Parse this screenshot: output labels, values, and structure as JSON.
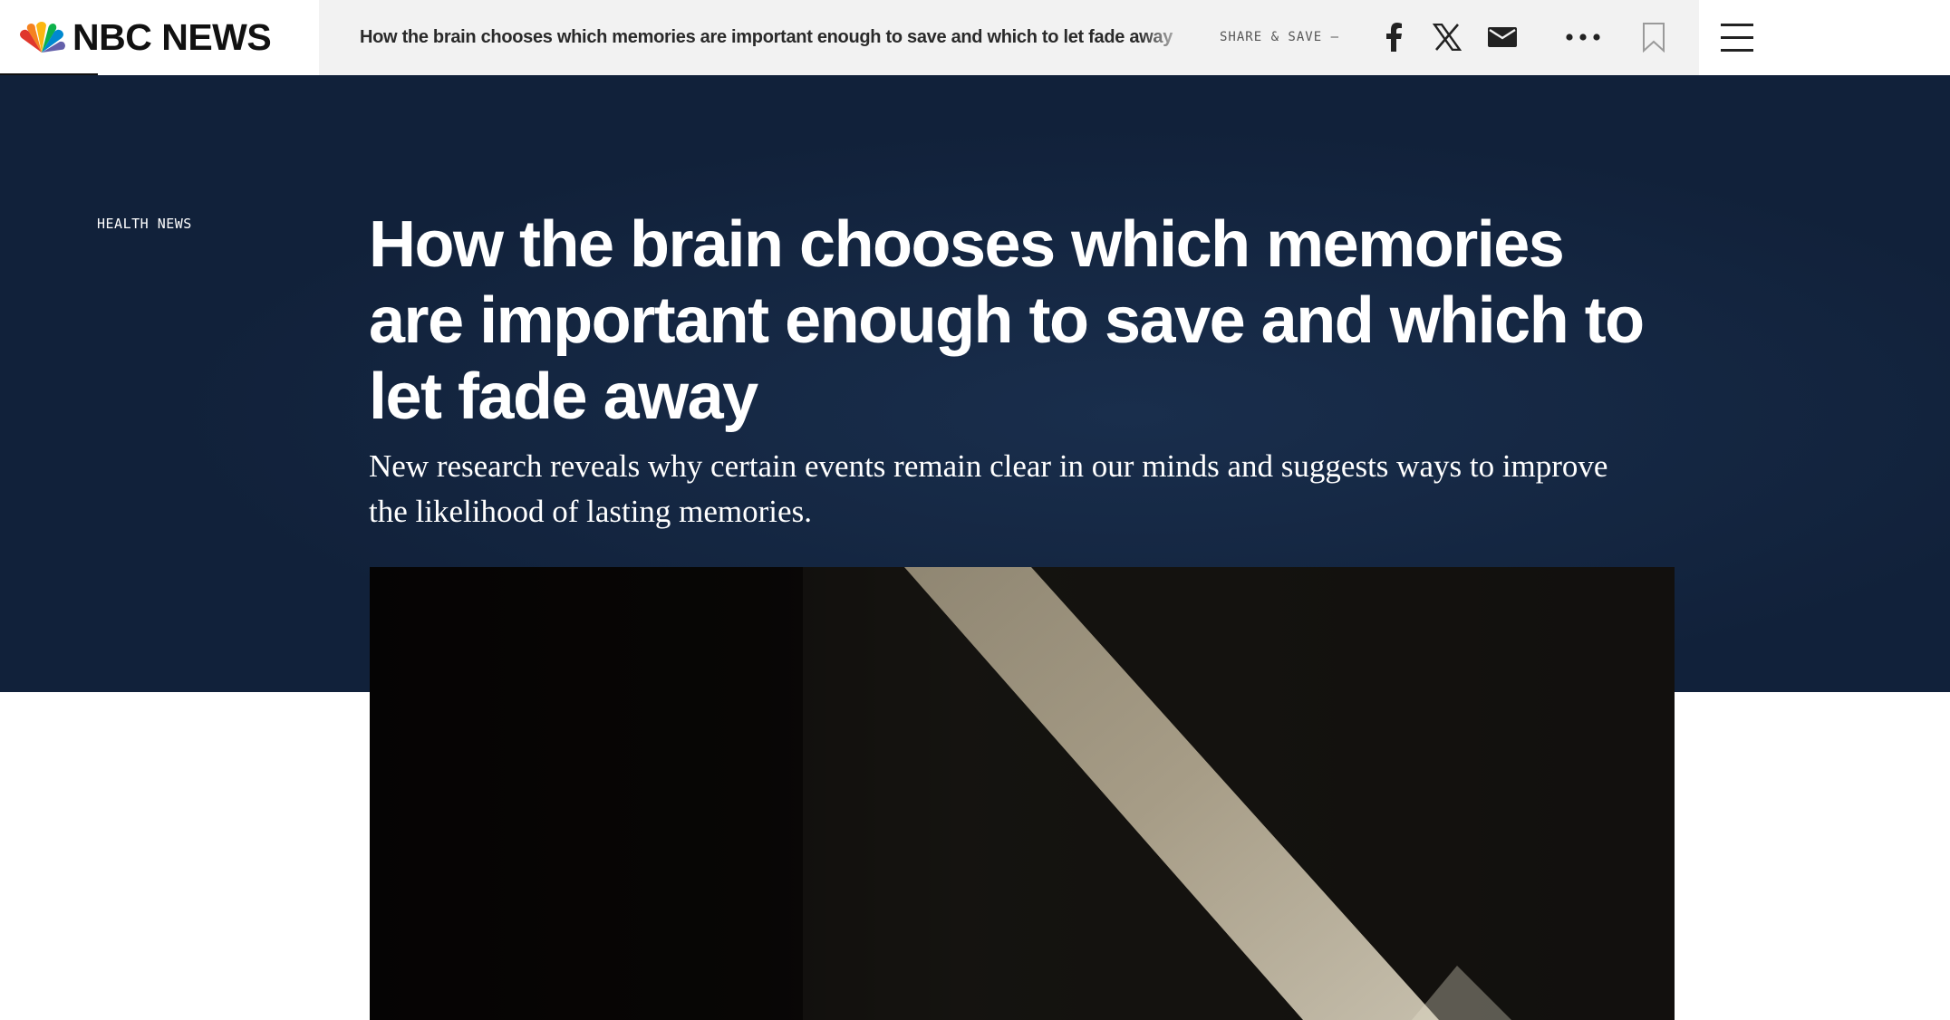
{
  "header": {
    "brand": "NBC NEWS",
    "sticky_title": "How the brain chooses which memories are important enough to save and which to let fade away",
    "share_label": "SHARE & SAVE –",
    "icons": [
      "facebook-icon",
      "x-icon",
      "email-icon",
      "more-icon",
      "bookmark-icon",
      "menu-icon"
    ]
  },
  "article": {
    "category": "HEALTH NEWS",
    "headline": "How the brain chooses which memories are important enough to save and which to let fade away",
    "dek": "New research reveals why certain events remain clear in our minds and suggests ways to improve the likelihood of lasting memories."
  },
  "colors": {
    "hero_background": "#11213a",
    "sticky_background": "#f2f2f2",
    "text_dark": "#111111"
  }
}
